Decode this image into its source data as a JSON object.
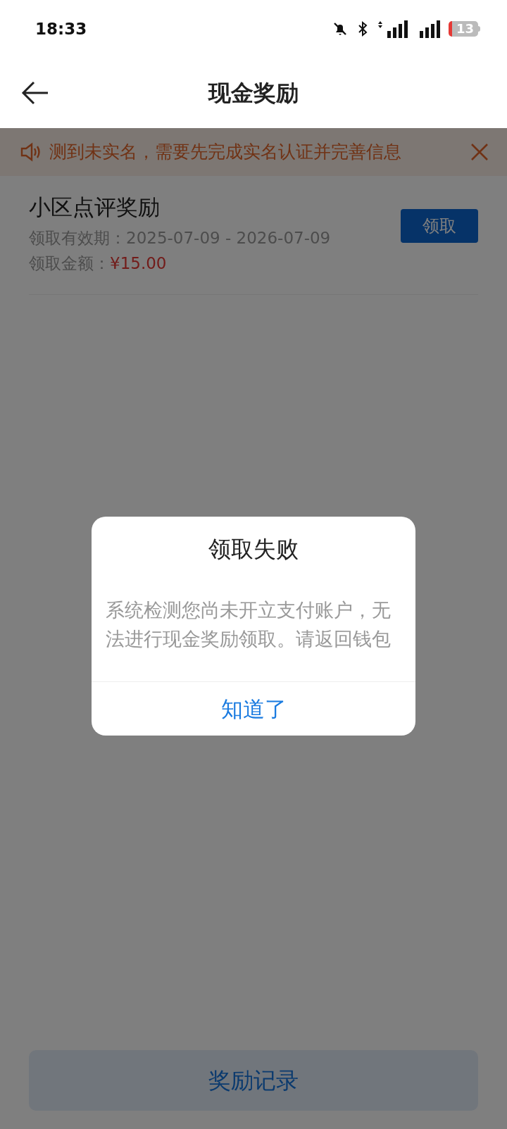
{
  "status_bar": {
    "time": "18:33",
    "battery": "13"
  },
  "nav": {
    "title": "现金奖励"
  },
  "notice": {
    "text": "测到未实名，需要先完成实名认证并完善信息"
  },
  "rewards": [
    {
      "title": "小区点评奖励",
      "period_label": "领取有效期：",
      "period": "2025-07-09 - 2026-07-09",
      "amount_label": "领取金额：",
      "amount": "¥15.00",
      "button": "领取"
    }
  ],
  "dialog": {
    "title": "领取失败",
    "message": "系统检测您尚未开立支付账户，无法进行现金奖励领取。请返回钱包",
    "button": "知道了"
  },
  "footer_button": "奖励记录"
}
